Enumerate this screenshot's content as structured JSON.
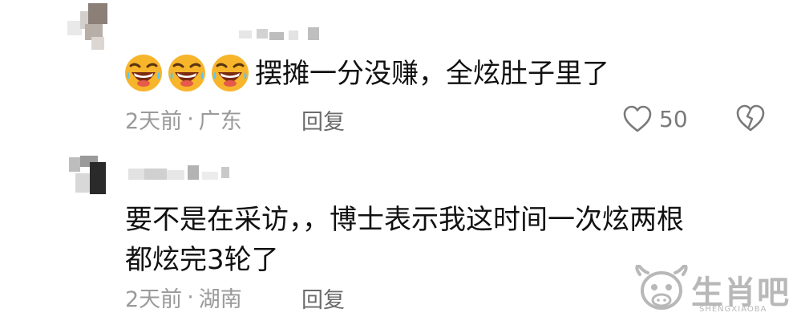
{
  "comments": [
    {
      "text": "摆摊一分没赚，全炫肚子里了",
      "emoji_count": 3,
      "emoji": "laughing-crying-emoji",
      "time": "2天前",
      "separator": "·",
      "location": "广东",
      "reply_label": "回复",
      "like_count": "50"
    },
    {
      "text_line1": "要不是在采访，，博士表示我这时间一次炫两根",
      "text_line2": "都炫完3轮了",
      "time": "2天前",
      "separator": "·",
      "location": "湖南",
      "reply_label": "回复"
    }
  ],
  "watermark": {
    "title": "生肖吧",
    "subtitle": "SHENGXIAOBA"
  },
  "icons": {
    "like": "heart-outline-icon",
    "dislike": "broken-heart-icon"
  }
}
